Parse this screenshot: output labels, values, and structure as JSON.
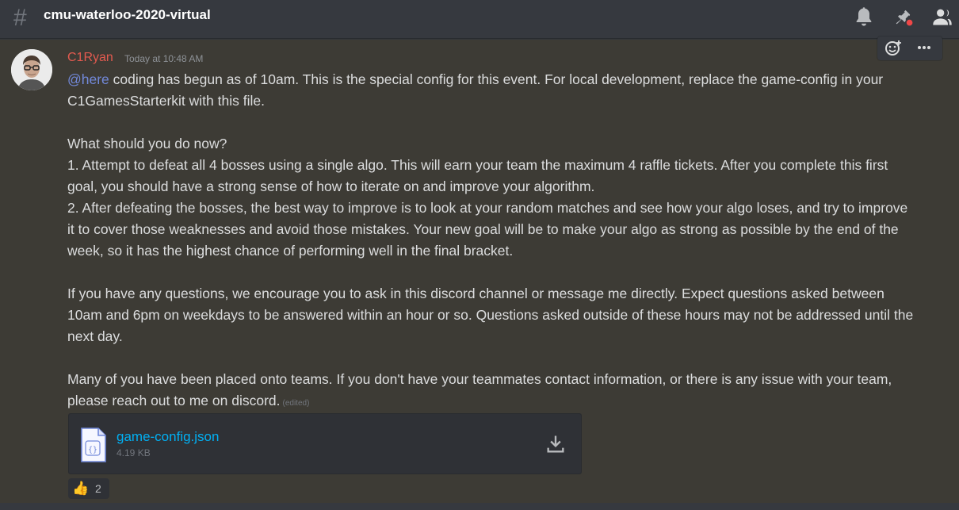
{
  "header": {
    "channel_name": "cmu-waterloo-2020-virtual"
  },
  "message": {
    "author": "C1Ryan",
    "author_color": "#e35a4f",
    "timestamp": "Today at 10:48 AM",
    "mention": "@here",
    "paragraphs": [
      " coding has begun as of 10am. This is the special config for this event. For local development, replace the game-config in your C1GamesStarterkit with this file.",
      "What should you do now?",
      "1. Attempt to defeat all 4 bosses using a single algo. This will earn your team the maximum 4 raffle tickets. After you complete this first goal, you should have a strong sense of how to iterate on and improve your algorithm.",
      "2. After defeating the bosses, the best way to improve is to look at your random matches and see how your algo loses, and try to improve it to cover those weaknesses and avoid those mistakes. Your new goal will be to make your algo as strong as possible by the end of the week, so it has the highest chance of performing well in the final bracket.",
      "If you have any questions, we encourage you to ask in this discord channel or message me directly. Expect questions asked between 10am and 6pm on weekdays to be answered within an hour or so. Questions asked outside of these hours may not be addressed until the next day.",
      "Many of you have been placed onto teams. If you don't have your teammates contact information, or there is any issue with your team, please reach out to me on discord."
    ],
    "edited_label": "(edited)"
  },
  "attachment": {
    "file_name": "game-config.json",
    "file_size": "4.19 KB",
    "file_icon_glyph": "{}"
  },
  "reaction": {
    "emoji": "👍",
    "count": "2"
  },
  "icons": {
    "header": [
      "bell-icon",
      "pin-icon",
      "members-icon"
    ],
    "toolbar": [
      "add-reaction-icon",
      "more-icon"
    ]
  },
  "colors": {
    "mention": "#7289da",
    "link": "#00b0f4",
    "unread_dot": "#f04747"
  }
}
